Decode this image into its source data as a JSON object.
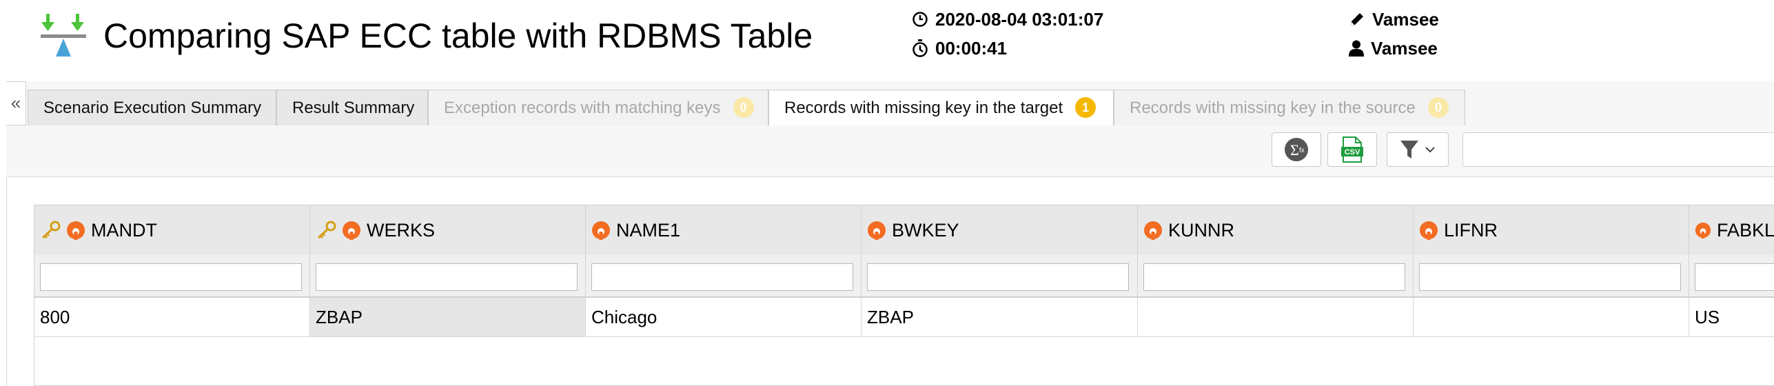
{
  "header": {
    "title": "Comparing SAP ECC table with RDBMS Table",
    "run_datetime": "2020-08-04 03:01:07",
    "duration": "00:00:41",
    "edited_by": "Vamsee",
    "owner": "Vamsee"
  },
  "collapse_label": "«",
  "tabs": [
    {
      "label": "Scenario Execution Summary",
      "state": "normal",
      "badge": null
    },
    {
      "label": "Result Summary",
      "state": "normal",
      "badge": null
    },
    {
      "label": "Exception records with matching keys",
      "state": "disabled",
      "badge": "0"
    },
    {
      "label": "Records with missing key in the target",
      "state": "active",
      "badge": "1"
    },
    {
      "label": "Records with missing key in the source",
      "state": "disabled",
      "badge": "0"
    }
  ],
  "toolbar": {
    "aggregate_icon": "sigma-icon",
    "export_icon": "csv-icon",
    "filter_icon": "filter-icon",
    "export_label": "CSV",
    "search_value": ""
  },
  "grid": {
    "columns": [
      {
        "name": "MANDT",
        "is_key": true
      },
      {
        "name": "WERKS",
        "is_key": true
      },
      {
        "name": "NAME1",
        "is_key": false
      },
      {
        "name": "BWKEY",
        "is_key": false
      },
      {
        "name": "KUNNR",
        "is_key": false
      },
      {
        "name": "LIFNR",
        "is_key": false
      },
      {
        "name": "FABKL",
        "is_key": false
      }
    ],
    "rows": [
      [
        "800",
        "ZBAP",
        "Chicago",
        "ZBAP",
        "",
        "",
        "US"
      ]
    ]
  },
  "colors": {
    "accent_orange": "#f26c21",
    "badge_yellow": "#f5b800",
    "logo_green": "#4cc33a",
    "logo_blue": "#4aa3d8"
  }
}
